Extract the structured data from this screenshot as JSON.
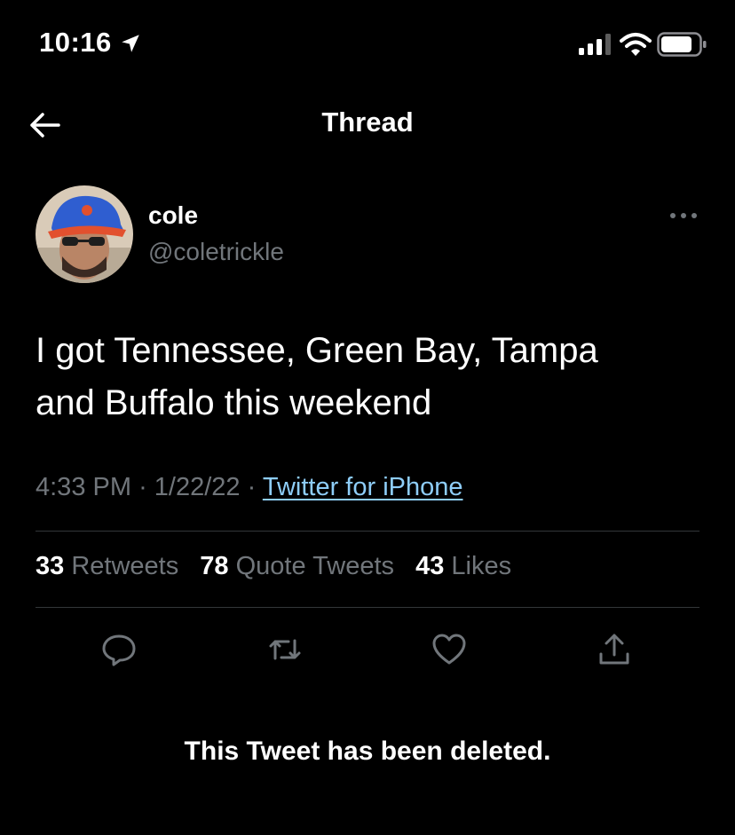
{
  "status_bar": {
    "time": "10:16",
    "location_icon": "location-arrow-icon",
    "signal_icon": "cellular-signal-icon",
    "wifi_icon": "wifi-icon",
    "battery_icon": "battery-icon"
  },
  "header": {
    "back_icon": "arrow-left-icon",
    "title": "Thread"
  },
  "tweet": {
    "author": {
      "name": "cole",
      "handle": "@coletrickle"
    },
    "more_icon": "ellipsis-icon",
    "text": "I got Tennessee, Green Bay, Tampa\nand Buffalo this weekend",
    "time": "4:33 PM",
    "separator": "·",
    "date": "1/22/22",
    "source": "Twitter for iPhone",
    "stats": {
      "retweets_count": "33",
      "retweets_label": "Retweets",
      "quote_tweets_count": "78",
      "quote_tweets_label": "Quote Tweets",
      "likes_count": "43",
      "likes_label": "Likes"
    },
    "actions": [
      "reply-icon",
      "retweet-icon",
      "like-icon",
      "share-icon"
    ]
  },
  "deleted_notice": "This Tweet has been deleted.",
  "colors": {
    "background": "#000000",
    "primary_text": "#ffffff",
    "secondary_text": "#71767b",
    "link": "#8ecdf8",
    "divider": "#333639"
  }
}
